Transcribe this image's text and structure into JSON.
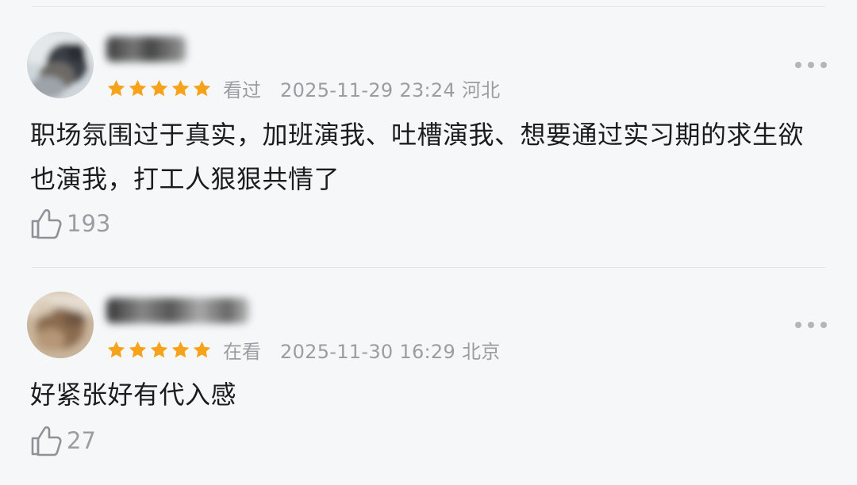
{
  "comments": [
    {
      "rating": 5,
      "status": "看过",
      "time": "2025-11-29 23:24 河北",
      "text": "职场氛围过于真实，加班演我、吐槽演我、想要通过实习期的求生欲也演我，打工人狠狠共情了",
      "likes": "193",
      "icons": {
        "avatar": "avatar",
        "more": "more-dots-icon",
        "like": "thumbs-up-icon",
        "star": "star-icon"
      }
    },
    {
      "rating": 5,
      "status": "在看",
      "time": "2025-11-30 16:29 北京",
      "text": "好紧张好有代入感",
      "likes": "27",
      "icons": {
        "avatar": "avatar",
        "more": "more-dots-icon",
        "like": "thumbs-up-icon",
        "star": "star-icon"
      }
    }
  ],
  "colors": {
    "star": "#f7a21b",
    "muted": "#9a9ea2",
    "background": "#f5f7f8"
  }
}
